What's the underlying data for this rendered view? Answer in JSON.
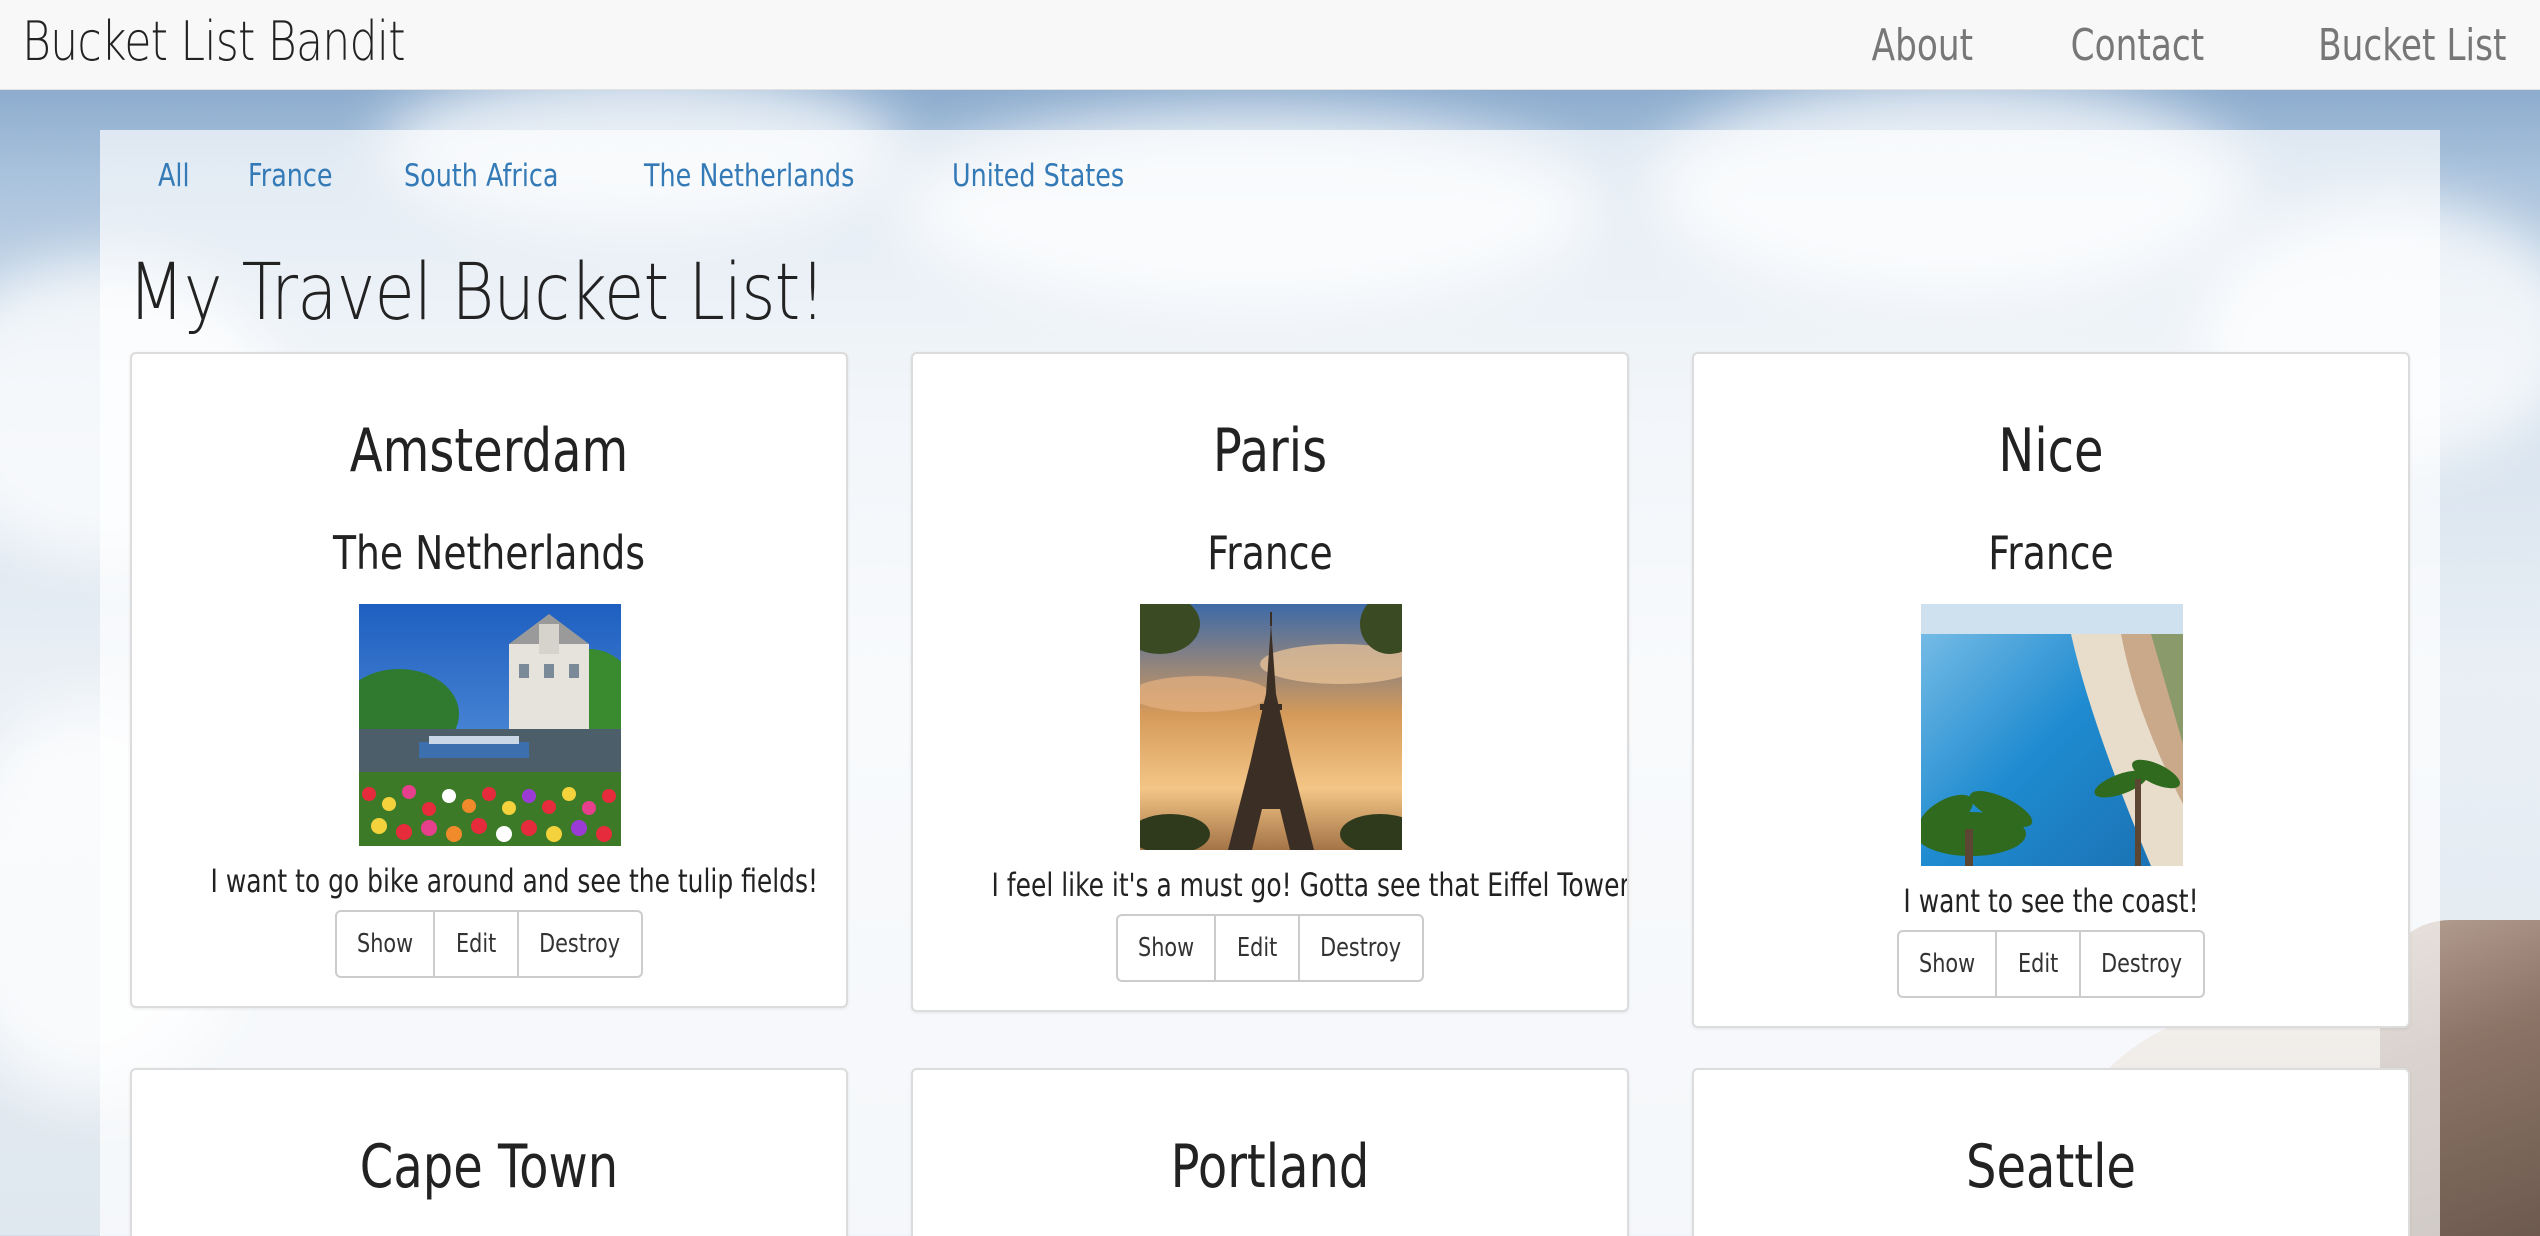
{
  "navbar": {
    "brand": "Bucket List Bandit",
    "links": [
      "About",
      "Contact",
      "Bucket List"
    ]
  },
  "filters": [
    "All",
    "France",
    "South Africa",
    "The Netherlands",
    "United States"
  ],
  "page_title": "My Travel Bucket List!",
  "buttons": {
    "show": "Show",
    "edit": "Edit",
    "destroy": "Destroy"
  },
  "cards": [
    {
      "city": "Amsterdam",
      "country": "The Netherlands",
      "description": "I want to go bike around and see the tulip fields!",
      "image": "amsterdam canal with tulips and boat"
    },
    {
      "city": "Paris",
      "country": "France",
      "description": "I feel like it's a must go! Gotta see that Eiffel Tower",
      "image": "eiffel tower at sunset"
    },
    {
      "city": "Nice",
      "country": "France",
      "description": "I want to see the coast!",
      "image": "nice coastline beach with palm trees"
    },
    {
      "city": "Cape Town"
    },
    {
      "city": "Portland"
    },
    {
      "city": "Seattle"
    }
  ],
  "colors": {
    "link": "#337ab7",
    "nav_text": "#777777",
    "navbar_bg": "#f8f8f8"
  }
}
